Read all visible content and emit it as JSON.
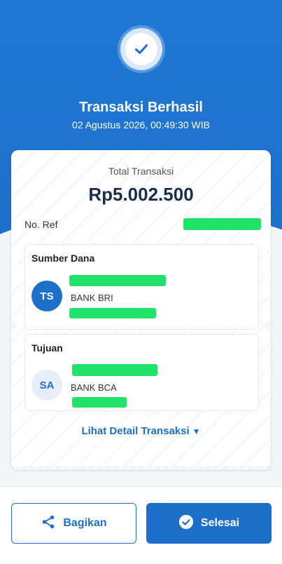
{
  "header": {
    "title": "Transaksi Berhasil",
    "datetime": "02 Agustus 2026, 00:49:30 WIB",
    "status_icon": "check-circle-icon"
  },
  "summary": {
    "total_label": "Total Transaksi",
    "total_amount": "Rp5.002.500",
    "ref_label": "No. Ref",
    "ref_value_redacted": true
  },
  "source": {
    "title": "Sumber Dana",
    "initials": "TS",
    "bank": "BANK BRI",
    "name_redacted": true,
    "account_redacted": true
  },
  "destination": {
    "title": "Tujuan",
    "initials": "SA",
    "bank": "BANK BCA",
    "name_redacted": true,
    "account_redacted": true
  },
  "detail_link": {
    "label": "Lihat Detail Transaksi",
    "icon": "chevron-down-icon"
  },
  "actions": {
    "share_label": "Bagikan",
    "share_icon": "share-icon",
    "done_label": "Selesai",
    "done_icon": "check-circle-icon"
  },
  "colors": {
    "primary": "#1d6fc9",
    "redaction": "#22e36a",
    "amount": "#1a2e4a"
  }
}
